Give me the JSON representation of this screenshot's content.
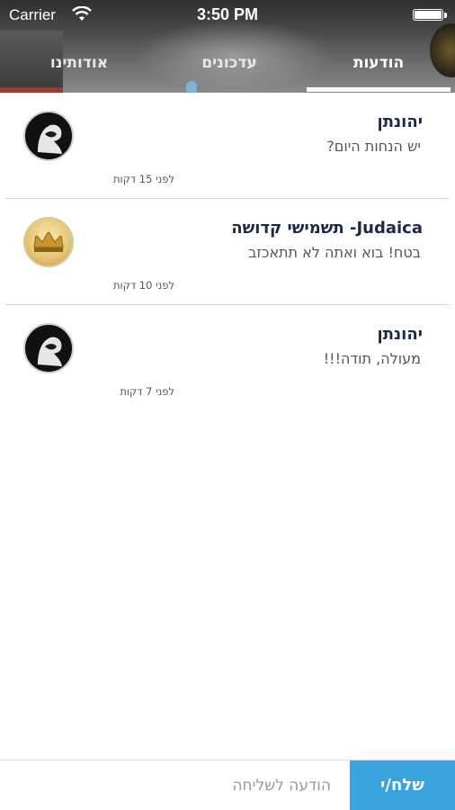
{
  "status_bar": {
    "carrier": "Carrier",
    "time": "3:50 PM"
  },
  "tabs": [
    {
      "label": "הודעות",
      "active": true
    },
    {
      "label": "עדכונים",
      "active": false
    },
    {
      "label": "אודותינו",
      "active": false
    }
  ],
  "messages": [
    {
      "sender": "יהונתן",
      "preview": "יש הנחות היום?",
      "time": "לפני 15 דקות",
      "avatar": "hooded-figure"
    },
    {
      "sender": "Judaica- תשמישי קדושה",
      "preview": "בטח! בוא ואתה לא תתאכזב",
      "time": "לפני 10 דקות",
      "avatar": "gold-crown-logo"
    },
    {
      "sender": "יהונתן",
      "preview": "מעולה, תודה!!!",
      "time": "לפני 7 דקות",
      "avatar": "hooded-figure"
    }
  ],
  "composer": {
    "placeholder": "הודעה לשליחה",
    "send_label": "שלח/י"
  },
  "colors": {
    "accent": "#3aa3dd",
    "sender_text": "#1c2a44"
  }
}
